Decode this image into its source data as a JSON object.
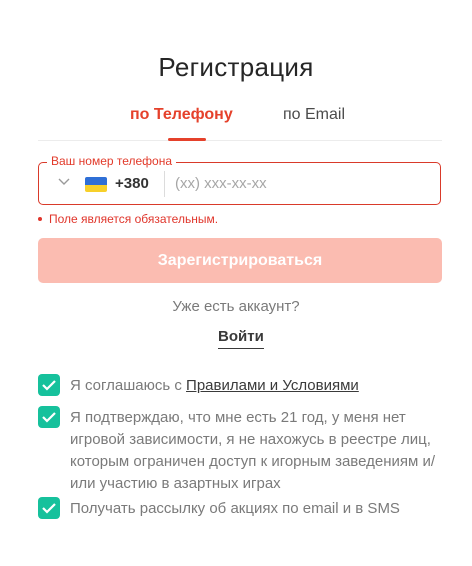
{
  "page": {
    "title": "Регистрация"
  },
  "tabs": [
    {
      "label": "по Телефону",
      "active": true
    },
    {
      "label": "по Email",
      "active": false
    }
  ],
  "phone": {
    "legend": "Ваш номер телефона",
    "country_flag": "ukraine-flag",
    "dial_code": "+380",
    "placeholder": "(xx) xxx-xx-xx",
    "value": "",
    "error": "Поле является обязательным."
  },
  "submit_label": "Зарегистрироваться",
  "account": {
    "question": "Уже есть аккаунт?",
    "login_label": "Войти"
  },
  "consents": [
    {
      "checked": true,
      "text": "Я соглашаюсь с ",
      "link": "Правилами и Условиями"
    },
    {
      "checked": true,
      "text": "Я подтверждаю, что мне есть 21 год, у меня нет игровой зависимости, я не нахожусь в реестре лиц, которым ограничен доступ к игорным заведениям и/или участию в азартных играх"
    },
    {
      "checked": true,
      "text": "Получать рассылку об акциях по email и в SMS"
    }
  ],
  "colors": {
    "accent": "#e5412b",
    "button_disabled": "#fbbcb1",
    "checkbox": "#16c19c",
    "error": "#e0352b"
  }
}
